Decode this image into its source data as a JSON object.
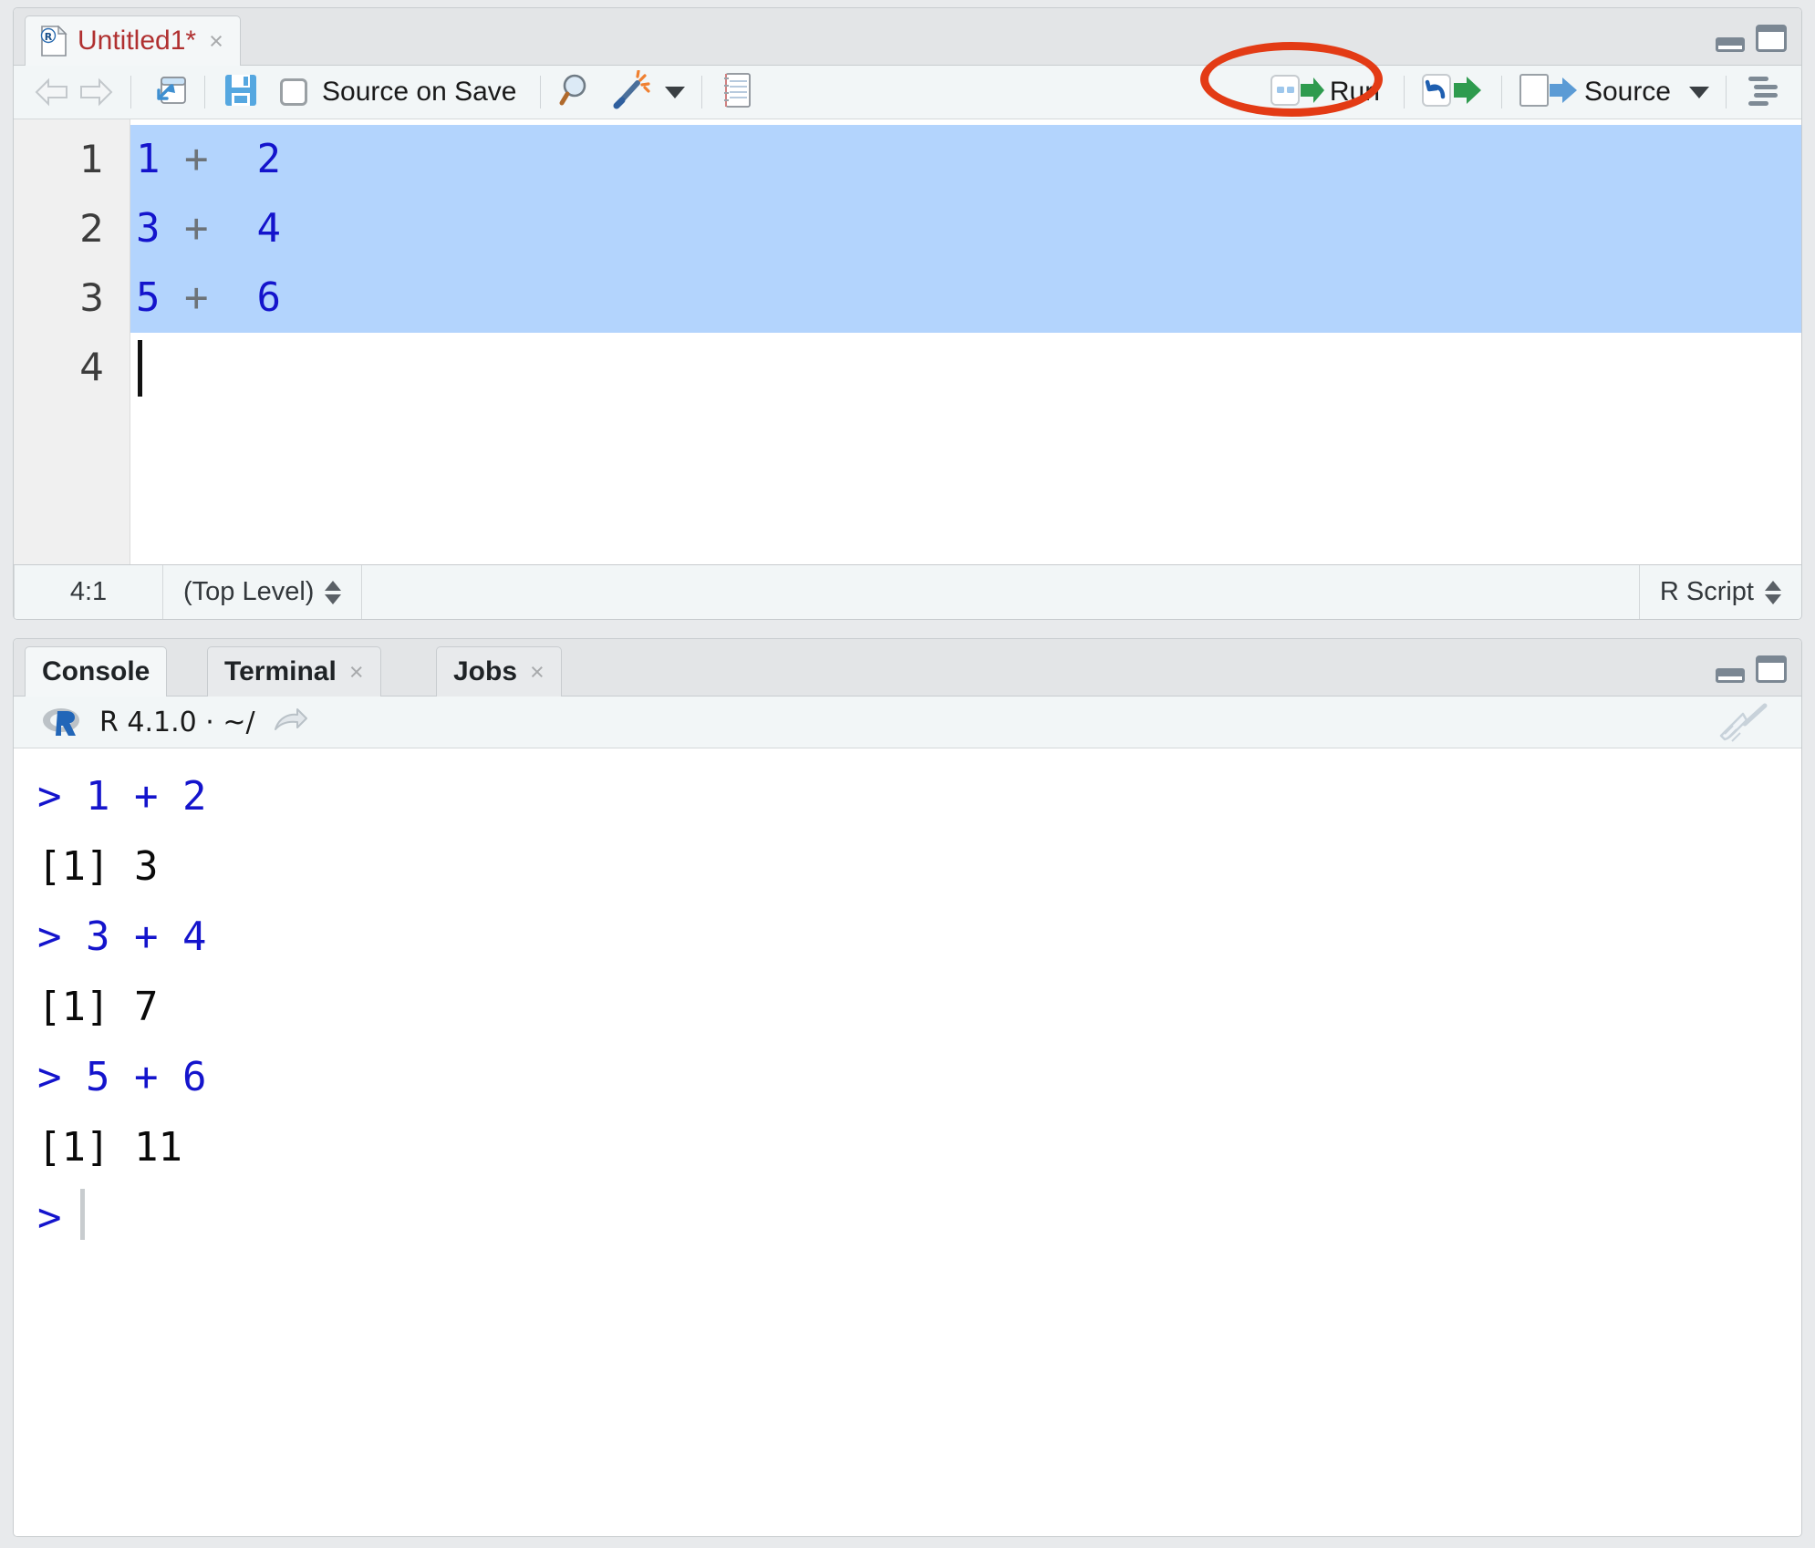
{
  "source_pane": {
    "tab": {
      "title": "Untitled1*",
      "close_glyph": "×",
      "icon": "r-script-file-icon"
    },
    "window_controls": {
      "minimize": "minimize-icon",
      "maximize": "maximize-icon"
    },
    "toolbar": {
      "back": "back-arrow-icon",
      "forward": "forward-arrow-icon",
      "popout": "show-in-new-window-icon",
      "save": "save-icon",
      "source_on_save_label": "Source on Save",
      "find": "find-replace-icon",
      "magic": "code-tools-icon",
      "magic_caret": "▾",
      "compile_report": "compile-report-icon",
      "run_label": "Run",
      "run_icon": "run-icon",
      "rerun_icon": "rerun-icon",
      "source_label": "Source",
      "source_icon": "source-icon",
      "source_caret": "▾",
      "outline": "document-outline-icon"
    },
    "annotation": {
      "shape": "ellipse",
      "color": "#e33b15",
      "target": "Run"
    },
    "editor": {
      "line_numbers": [
        "1",
        "2",
        "3",
        "4"
      ],
      "lines": [
        {
          "tokens": [
            {
              "t": "1",
              "k": "num"
            },
            {
              "t": " ",
              "k": "ws"
            },
            {
              "t": "+",
              "k": "op"
            },
            {
              "t": "  ",
              "k": "ws"
            },
            {
              "t": "2",
              "k": "num"
            }
          ],
          "selected": true
        },
        {
          "tokens": [
            {
              "t": "3",
              "k": "num"
            },
            {
              "t": " ",
              "k": "ws"
            },
            {
              "t": "+",
              "k": "op"
            },
            {
              "t": "  ",
              "k": "ws"
            },
            {
              "t": "4",
              "k": "num"
            }
          ],
          "selected": true
        },
        {
          "tokens": [
            {
              "t": "5",
              "k": "num"
            },
            {
              "t": " ",
              "k": "ws"
            },
            {
              "t": "+",
              "k": "op"
            },
            {
              "t": "  ",
              "k": "ws"
            },
            {
              "t": "6",
              "k": "num"
            }
          ],
          "selected": true
        },
        {
          "tokens": [],
          "selected": false
        }
      ]
    },
    "status_bar": {
      "cursor_position": "4:1",
      "scope": "(Top Level)",
      "file_type": "R Script"
    }
  },
  "console_pane": {
    "tabs": [
      {
        "label": "Console",
        "active": true,
        "closable": false,
        "close_glyph": "×"
      },
      {
        "label": "Terminal",
        "active": false,
        "closable": true,
        "close_glyph": "×"
      },
      {
        "label": "Jobs",
        "active": false,
        "closable": true,
        "close_glyph": "×"
      }
    ],
    "window_controls": {
      "minimize": "minimize-icon",
      "maximize": "maximize-icon"
    },
    "header": {
      "r_logo": "r-logo-icon",
      "version_path": "R 4.1.0  ·  ~/",
      "popout": "view-in-new-window-icon",
      "clear": "broom-clear-console-icon"
    },
    "output": [
      {
        "text": "> 1 + 2",
        "kind": "input"
      },
      {
        "text": "[1] 3",
        "kind": "output"
      },
      {
        "text": "> 3 + 4",
        "kind": "input"
      },
      {
        "text": "[1] 7",
        "kind": "output"
      },
      {
        "text": "> 5 + 6",
        "kind": "input"
      },
      {
        "text": "[1] 11",
        "kind": "output"
      },
      {
        "text": ">",
        "kind": "prompt"
      }
    ]
  },
  "colors": {
    "accent_blue": "#1414cc",
    "selection": "#b3d4fd",
    "tab_title_red": "#b03030",
    "annotation_red": "#e33b15",
    "run_green": "#2e9b4e",
    "source_blue": "#5b9bd5"
  }
}
